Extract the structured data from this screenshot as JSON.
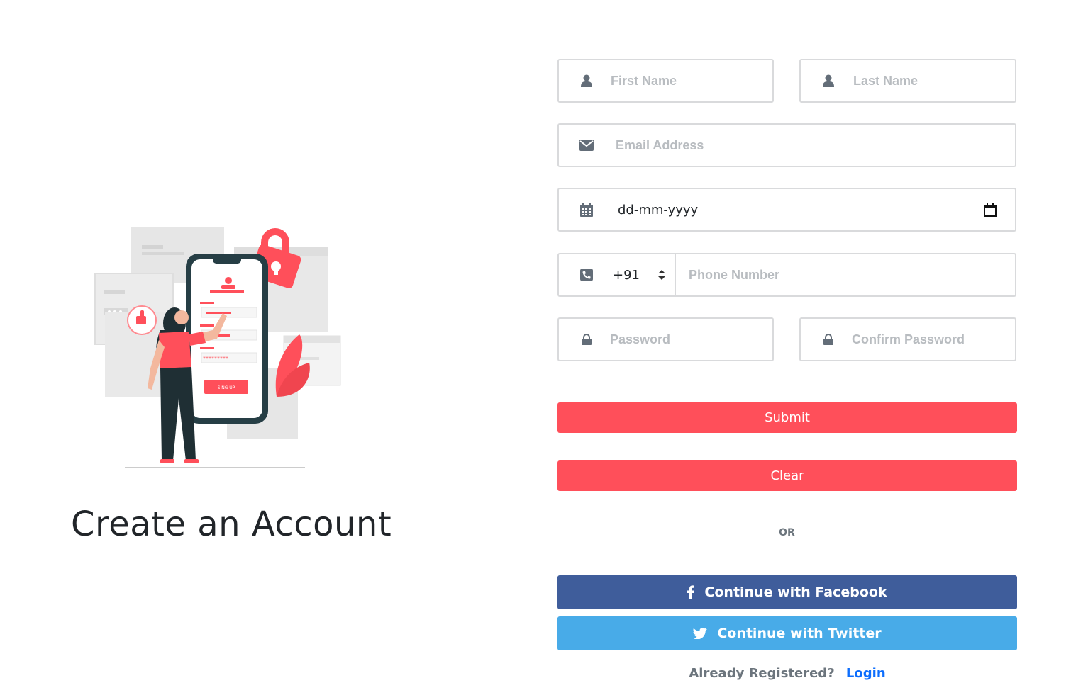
{
  "heading": "Create an Account",
  "form": {
    "first_name": {
      "placeholder": "First Name",
      "icon": "user-icon"
    },
    "last_name": {
      "placeholder": "Last Name",
      "icon": "user-icon"
    },
    "email": {
      "placeholder": "Email Address",
      "icon": "envelope-icon"
    },
    "dob": {
      "value": "dd-mm-yyyy",
      "icon": "calendar-icon",
      "picker_icon": "calendar-picker-icon"
    },
    "phone": {
      "country_code": "+91",
      "placeholder": "Phone Number",
      "icon": "phone-icon"
    },
    "password": {
      "placeholder": "Password",
      "icon": "lock-icon"
    },
    "confirm_password": {
      "placeholder": "Confirm Password",
      "icon": "lock-icon"
    },
    "submit_label": "Submit",
    "clear_label": "Clear"
  },
  "divider_label": "OR",
  "social": {
    "facebook_label": "Continue with Facebook",
    "twitter_label": "Continue with Twitter"
  },
  "footer": {
    "question": "Already Registered?",
    "login_label": "Login"
  },
  "illustration": {
    "button_text": "SING UP",
    "password_mask": "*********"
  },
  "colors": {
    "accent": "#ff4f5a",
    "facebook": "#3b5998",
    "twitter": "#48abe8",
    "link": "#0d6efd",
    "border": "#d9dadc"
  }
}
